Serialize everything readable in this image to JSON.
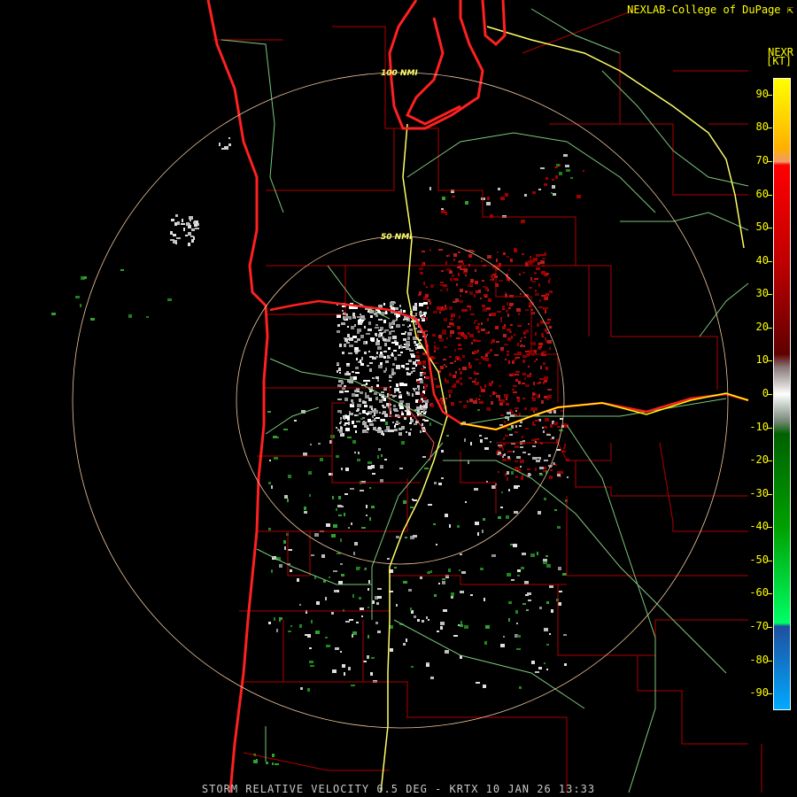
{
  "credit": "NEXLAB-College of DuPage",
  "credit_icon": "external-link-icon",
  "product_code": "NEXR",
  "unit": "[KT]",
  "footer": "STORM RELATIVE VELOCITY 0.5 DEG - KRTX 10 JAN 26 13:33",
  "range_rings": [
    {
      "label": "100 NMI",
      "nmi": 100
    },
    {
      "label": "50 NMI",
      "nmi": 50
    }
  ],
  "colorbar": {
    "ticks": [
      90,
      80,
      70,
      60,
      50,
      40,
      30,
      20,
      10,
      0,
      -10,
      -20,
      -30,
      -40,
      -50,
      -60,
      -70,
      -80,
      -90
    ],
    "stops": [
      {
        "value": 95,
        "color": "#ffff00"
      },
      {
        "value": 74,
        "color": "#ffb000"
      },
      {
        "value": 70,
        "color": "#f09a6a"
      },
      {
        "value": 69,
        "color": "#ff0000"
      },
      {
        "value": 40,
        "color": "#c00000"
      },
      {
        "value": 12,
        "color": "#600000"
      },
      {
        "value": 8,
        "color": "#8a7a7a"
      },
      {
        "value": 0,
        "color": "#ffffff"
      },
      {
        "value": -8,
        "color": "#7a8a7a"
      },
      {
        "value": -12,
        "color": "#006000"
      },
      {
        "value": -40,
        "color": "#00a000"
      },
      {
        "value": -69,
        "color": "#00ff66"
      },
      {
        "value": -70,
        "color": "#1f4f9f"
      },
      {
        "value": -95,
        "color": "#00aaff"
      }
    ]
  },
  "colors": {
    "coast": "#ff2020",
    "county": "#b00000",
    "state_border": "#ffff00",
    "highway": "#7cc87c",
    "ring": "#f0c8a0"
  }
}
